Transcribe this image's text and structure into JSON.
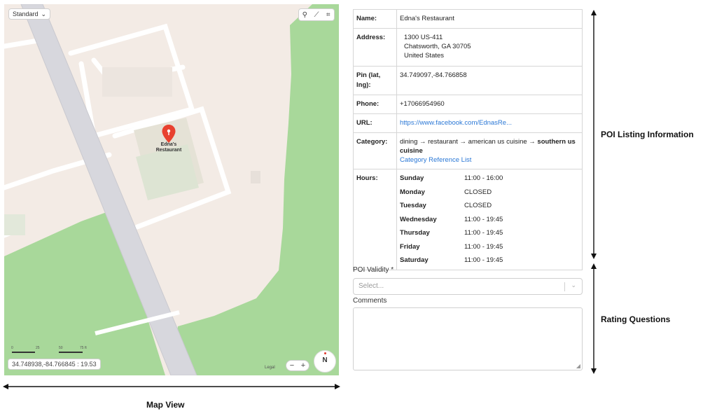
{
  "map": {
    "style_select": "Standard",
    "pin_label_line1": "Edna's",
    "pin_label_line2": "Restaurant",
    "coord_readout": "34.748938,-84.766845 : 19.53",
    "scale_labels": [
      "0",
      "25",
      "50",
      "75 ft"
    ],
    "legal": "Legal",
    "zoom_out": "−",
    "zoom_in": "+",
    "compass": "N",
    "colors": {
      "land": "#f3ebe5",
      "park": "#a8d89a",
      "road": "#d7d7dd",
      "building": "#e9e2dc",
      "footprint": "#dfe5d6",
      "pin": "#e8412f"
    }
  },
  "info": {
    "name_key": "Name:",
    "name": "Edna's Restaurant",
    "address_key": "Address:",
    "address_line1": "1300 US-411",
    "address_line2": "Chatsworth, GA 30705",
    "address_line3": "United States",
    "pin_key_line1": "Pin (lat,",
    "pin_key_line2": "lng):",
    "pin": "34.749097,-84.766858",
    "phone_key": "Phone:",
    "phone": "+17066954960",
    "url_key": "URL:",
    "url": "https://www.facebook.com/EdnasRe...",
    "category_key": "Category:",
    "category_path": "dining → restaurant → american us cuisine → ",
    "category_last": "southern us cuisine",
    "category_link": "Category Reference List",
    "hours_key": "Hours:",
    "hours": [
      {
        "day": "Sunday",
        "time": "11:00 - 16:00"
      },
      {
        "day": "Monday",
        "time": "CLOSED"
      },
      {
        "day": "Tuesday",
        "time": "CLOSED"
      },
      {
        "day": "Wednesday",
        "time": "11:00 - 19:45"
      },
      {
        "day": "Thursday",
        "time": "11:00 - 19:45"
      },
      {
        "day": "Friday",
        "time": "11:00 - 19:45"
      },
      {
        "day": "Saturday",
        "time": "11:00 - 19:45"
      }
    ]
  },
  "form": {
    "validity_label": "POI Validity *",
    "validity_placeholder": "Select...",
    "comments_label": "Comments"
  },
  "annotations": {
    "poi_listing": "POI Listing Information",
    "rating_questions": "Rating Questions",
    "map_view": "Map View"
  }
}
